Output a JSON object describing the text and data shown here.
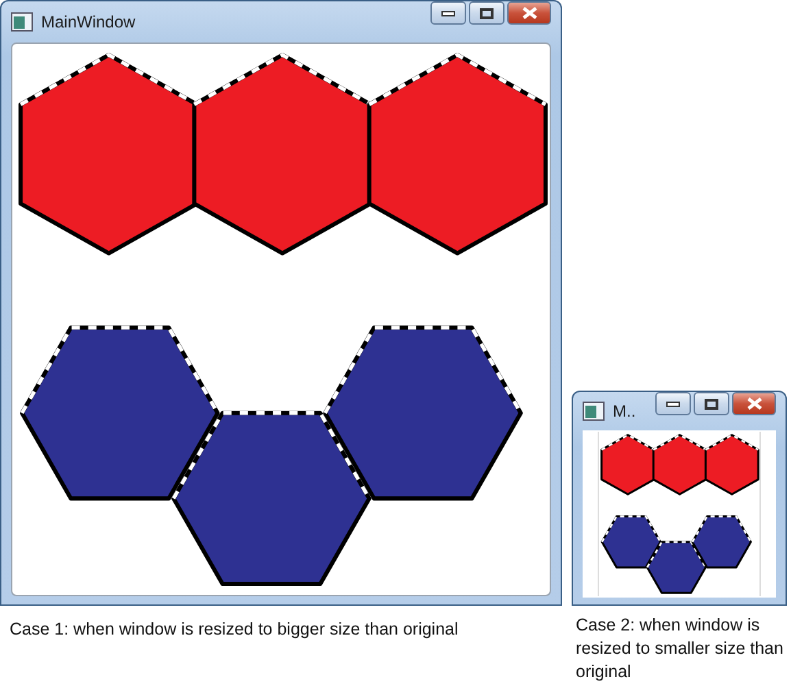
{
  "windows": [
    {
      "title": "MainWindow",
      "kind": "large",
      "caption": "Case 1: when window is resized to bigger size than original",
      "rows": [
        {
          "kind": "straight",
          "color": "#ed1c24"
        },
        {
          "kind": "arched",
          "color": "#2e3192"
        }
      ]
    },
    {
      "title": "M..",
      "kind": "small",
      "caption": "Case 2: when window is resized to smaller size than original",
      "rows": [
        {
          "kind": "straight",
          "color": "#ed1c24"
        },
        {
          "kind": "arched",
          "color": "#2e3192"
        }
      ]
    }
  ]
}
